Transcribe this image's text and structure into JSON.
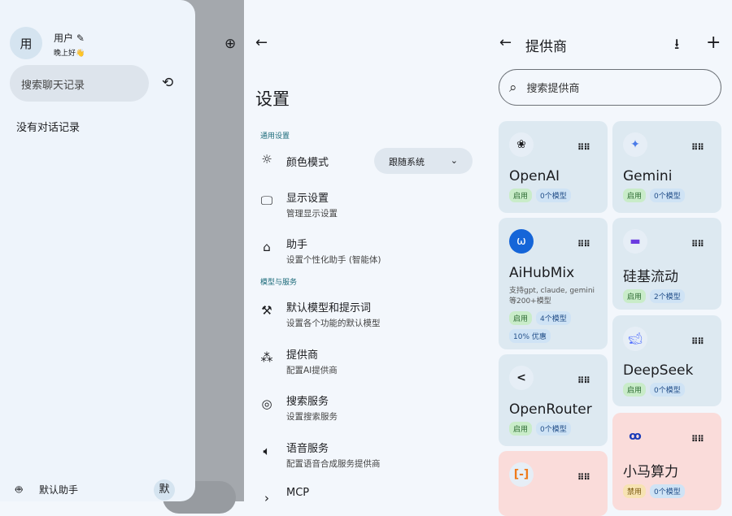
{
  "drawer": {
    "avatar": "用",
    "user": "用户",
    "greeting": "晚上好",
    "search_placeholder": "搜索聊天记录",
    "empty": "没有对话记录",
    "assistant": "默认助手",
    "assistant_avatar": "默"
  },
  "settings": {
    "title": "设置",
    "sections": [
      "通用设置",
      "模型与服务"
    ],
    "color_mode": {
      "label": "颜色模式",
      "value": "跟随系统"
    },
    "items": [
      {
        "title": "显示设置",
        "sub": "管理显示设置"
      },
      {
        "title": "助手",
        "sub": "设置个性化助手 (智能体)"
      },
      {
        "title": "默认模型和提示词",
        "sub": "设置各个功能的默认模型"
      },
      {
        "title": "提供商",
        "sub": "配置AI提供商"
      },
      {
        "title": "搜索服务",
        "sub": "设置搜索服务"
      },
      {
        "title": "语音服务",
        "sub": "配置语音合成服务提供商"
      },
      {
        "title": "MCP",
        "sub": ""
      }
    ]
  },
  "providers": {
    "title": "提供商",
    "search_placeholder": "搜索提供商",
    "cards": [
      {
        "name": "OpenAI",
        "status": "启用",
        "models": "0个模型"
      },
      {
        "name": "Gemini",
        "status": "启用",
        "models": "0个模型"
      },
      {
        "name": "AiHubMix",
        "desc": "支持gpt, claude, gemini等200+模型",
        "status": "启用",
        "models": "4个模型",
        "extra": "10% 优惠"
      },
      {
        "name": "硅基流动",
        "status": "启用",
        "models": "2个模型"
      },
      {
        "name": "DeepSeek",
        "status": "启用",
        "models": "0个模型"
      },
      {
        "name": "OpenRouter",
        "status": "启用",
        "models": "0个模型"
      },
      {
        "name": "小马算力",
        "status": "禁用",
        "models": "0个模型"
      }
    ]
  }
}
